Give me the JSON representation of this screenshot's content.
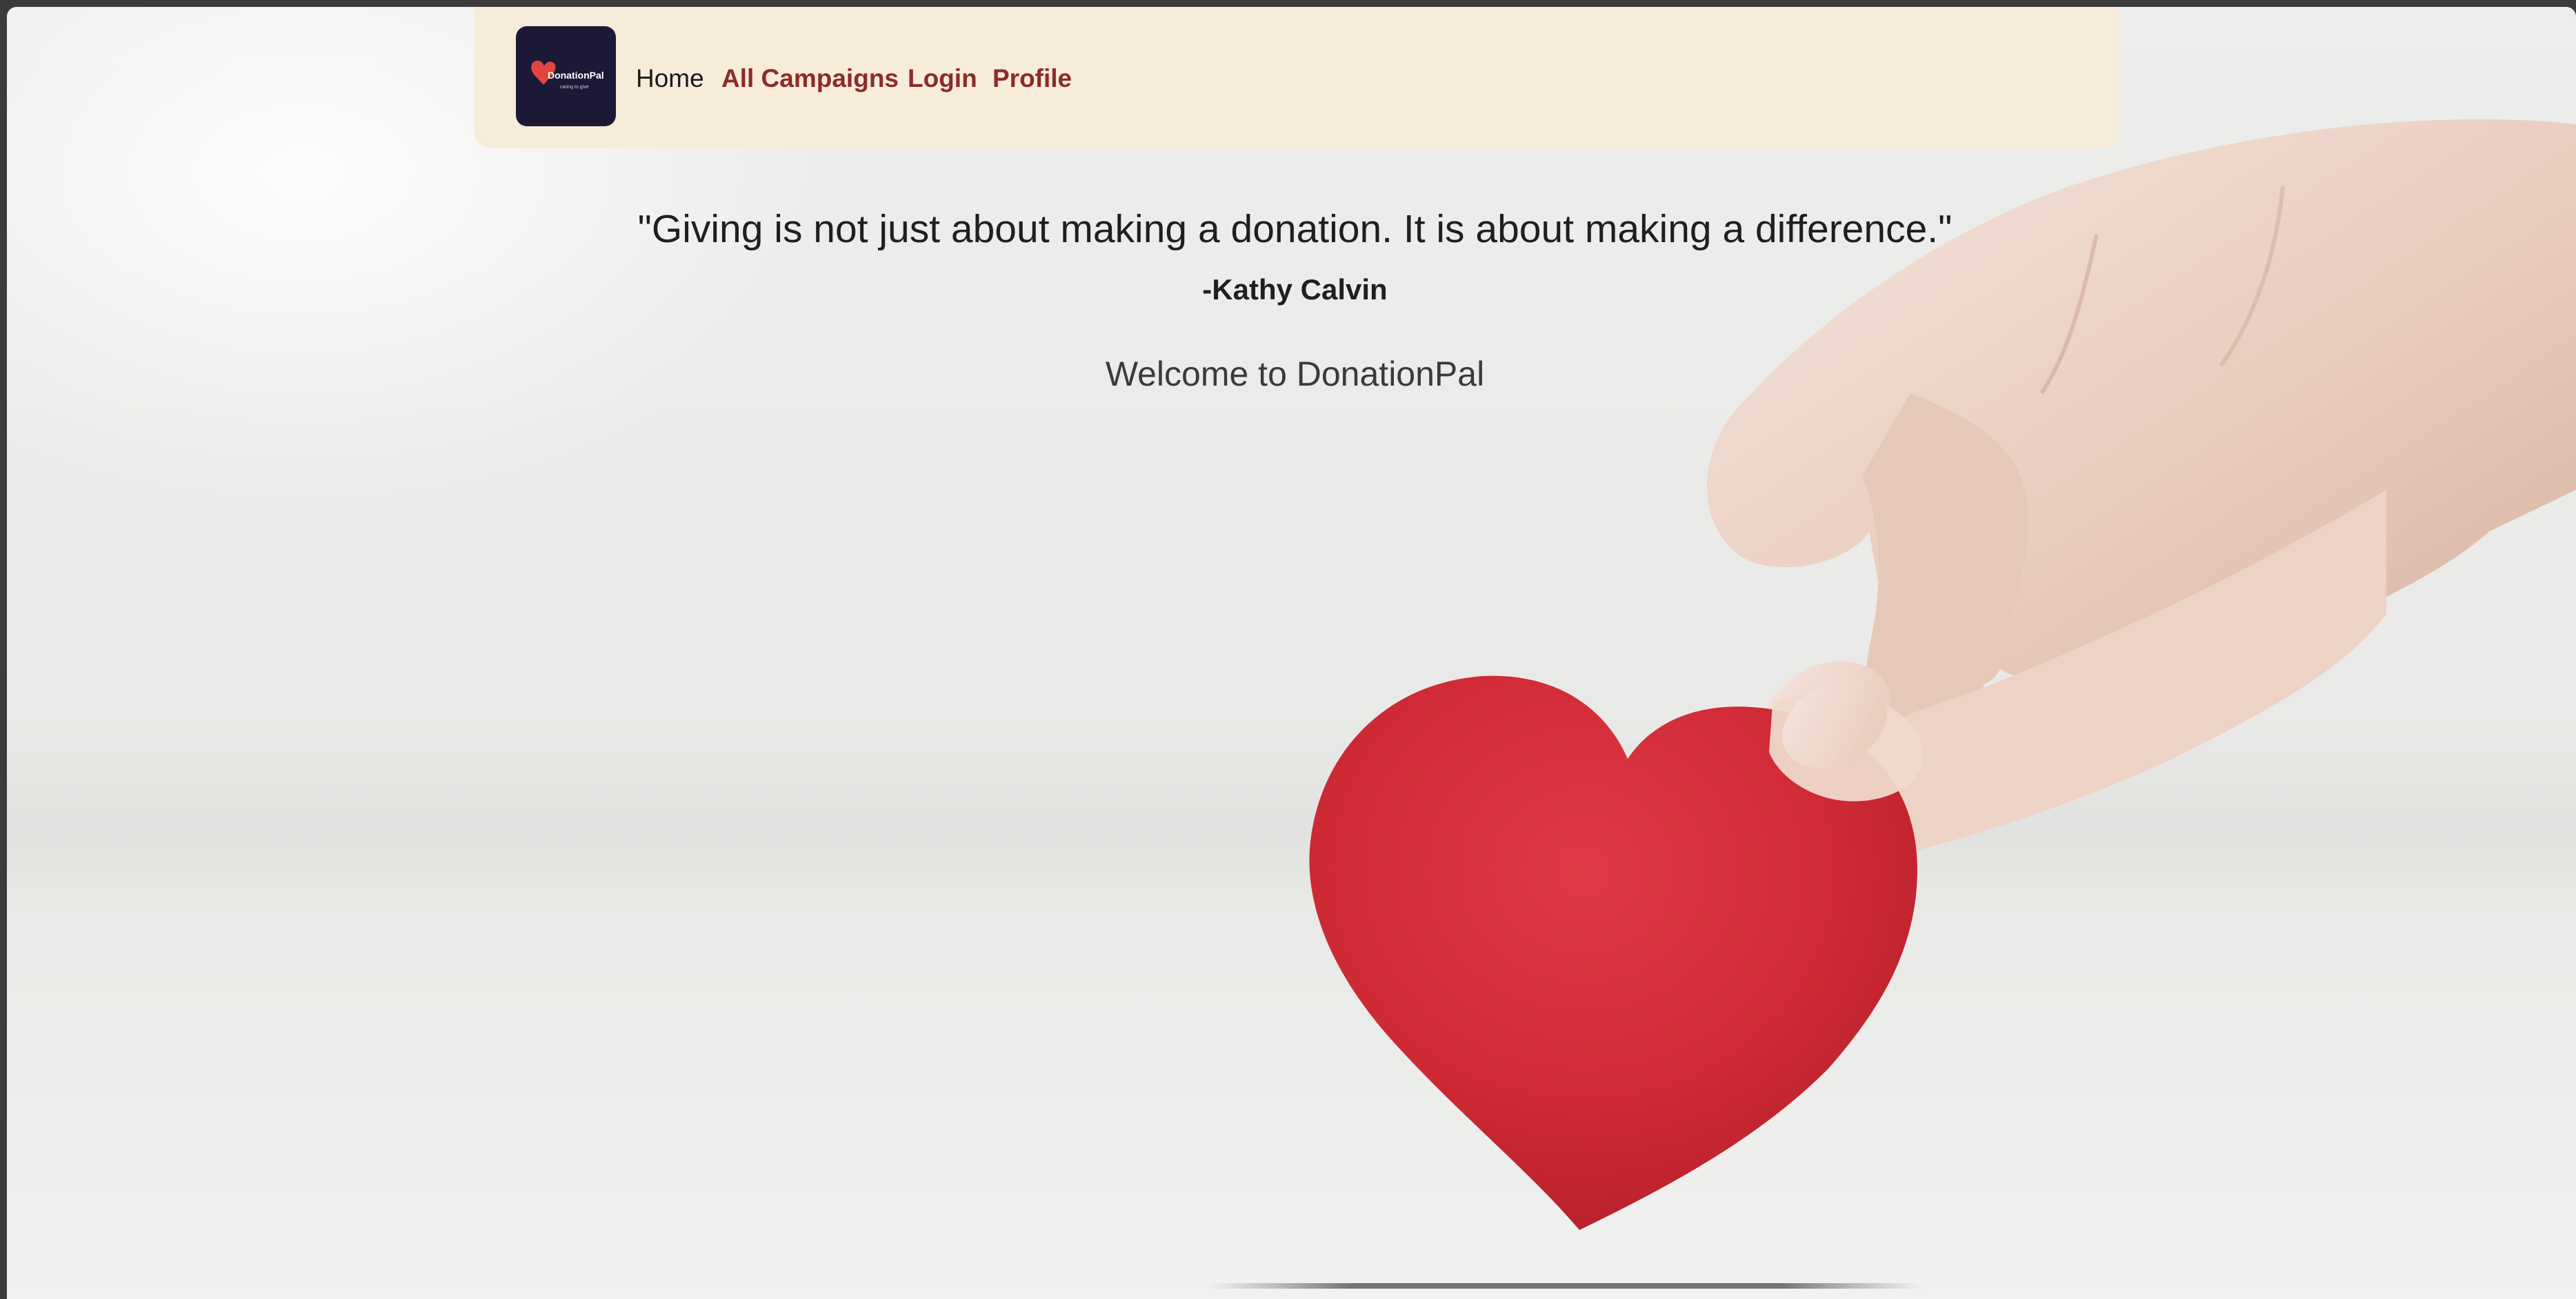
{
  "brand": {
    "logo_text": "DonationPal",
    "logo_tagline": "caring to give"
  },
  "nav": {
    "home": "Home",
    "all_campaigns": "All Campaigns",
    "login": "Login",
    "profile": "Profile"
  },
  "hero": {
    "quote": "\"Giving is not just about making a donation. It is about making a difference.\"",
    "author": "-Kathy Calvin",
    "welcome": "Welcome to DonationPal"
  },
  "colors": {
    "navbar_bg": "#f7ebd9",
    "link_accent": "#8c2b2a",
    "logo_bg": "#1c1937",
    "heart": "#d42a36"
  }
}
